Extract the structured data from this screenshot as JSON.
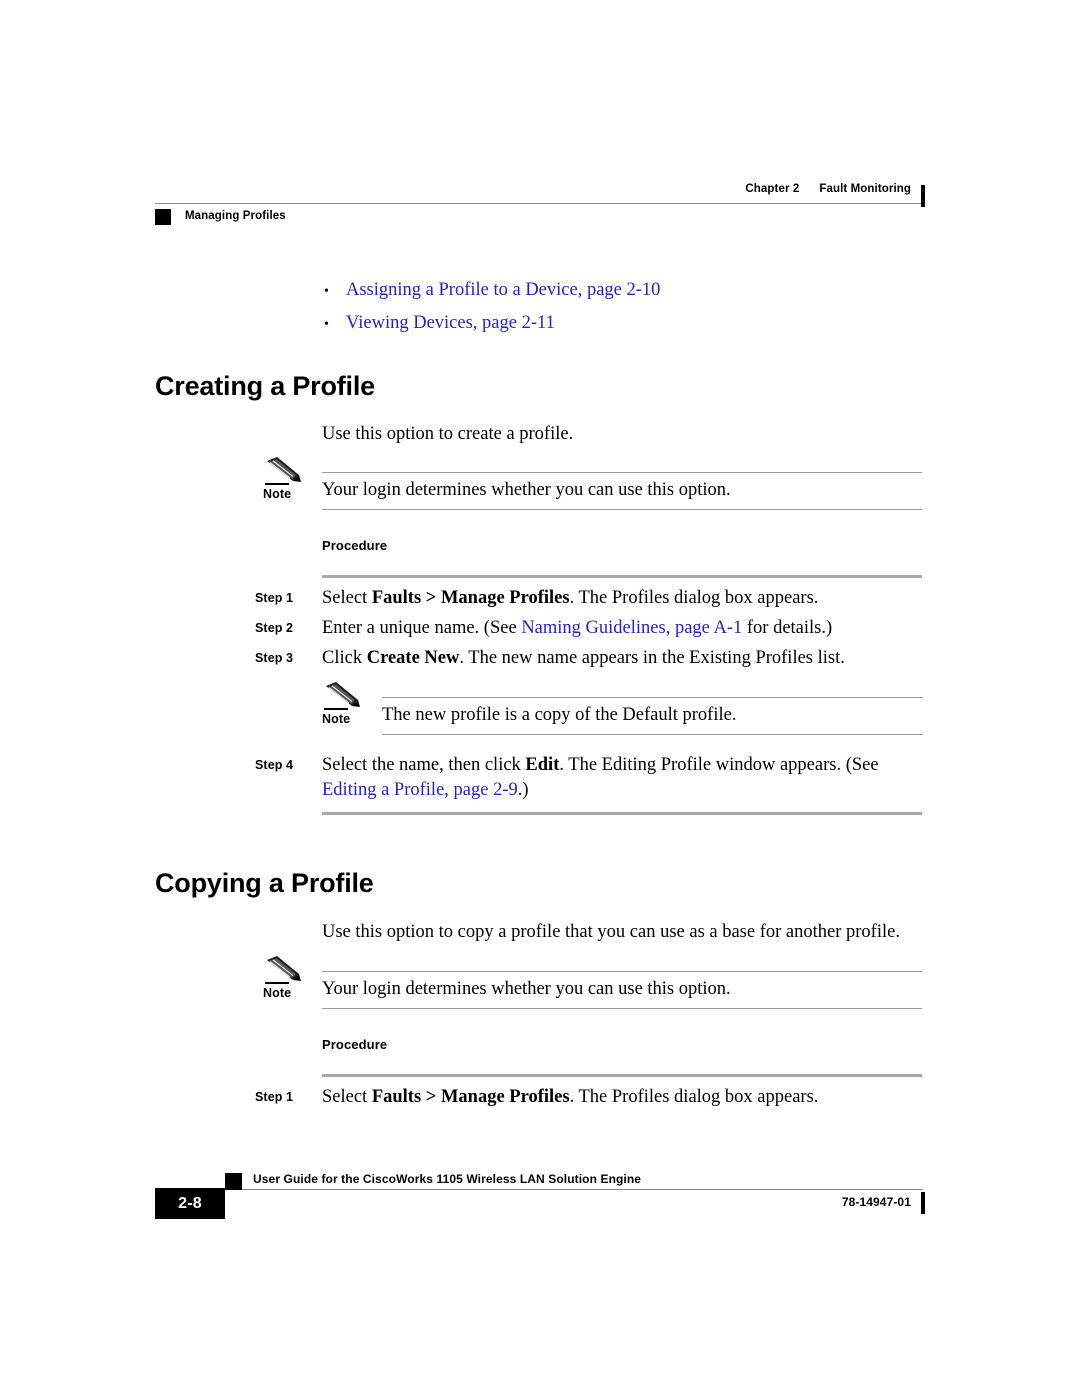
{
  "header": {
    "chapter": "Chapter 2",
    "chapter_title": "Fault Monitoring",
    "section": "Managing Profiles"
  },
  "crossref_list": [
    {
      "bullet": "•",
      "text": "Assigning a Profile to a Device, page 2-10"
    },
    {
      "bullet": "•",
      "text": "Viewing Devices, page 2-11"
    }
  ],
  "sections": [
    {
      "title": "Creating a Profile",
      "intro": "Use this option to create a profile.",
      "note_label": "Note",
      "note_text": "Your login determines whether you can use this option.",
      "procedure_label": "Procedure"
    },
    {
      "title": "Copying a Profile",
      "intro": "Use this option to copy a profile that you can use as a base for another profile.",
      "note_label": "Note",
      "note_text": "Your login determines whether you can use this option.",
      "procedure_label": "Procedure"
    }
  ],
  "steps_creating": {
    "step1": {
      "num": "Step 1",
      "pre": "Select ",
      "bold": "Faults > Manage Profiles",
      "post": ". The Profiles dialog box appears."
    },
    "step2": {
      "num": "Step 2",
      "pre": "Enter a unique name. (See ",
      "link": "Naming Guidelines, page A-1",
      "post": " for details.)"
    },
    "step3": {
      "num": "Step 3",
      "pre": "Click ",
      "bold": "Create New",
      "post": ". The new name appears in the Existing Profiles list."
    },
    "nested_note": {
      "label": "Note",
      "text": "The new profile is a copy of the Default profile."
    },
    "step4": {
      "num": "Step 4",
      "pre": "Select the name, then click ",
      "bold": "Edit",
      "mid": ". The Editing Profile window appears. (See ",
      "link": "Editing a Profile, page 2-9",
      "post": ".)"
    }
  },
  "steps_copying": {
    "step1": {
      "num": "Step 1",
      "pre": "Select ",
      "bold": "Faults > Manage Profiles",
      "post": ". The Profiles dialog box appears."
    }
  },
  "footer": {
    "page_number": "2-8",
    "doc_title": "User Guide for the CiscoWorks 1105 Wireless LAN Solution Engine",
    "doc_number": "78-14947-01"
  },
  "colors": {
    "link": "#2222cc",
    "rule_gray": "#9a9a9a",
    "step_rule_gray": "#a8a8a8",
    "black": "#000000"
  },
  "icons": {
    "note": "pencil-icon",
    "header_marker": "black-square-marker",
    "footer_marker": "black-square-marker"
  }
}
